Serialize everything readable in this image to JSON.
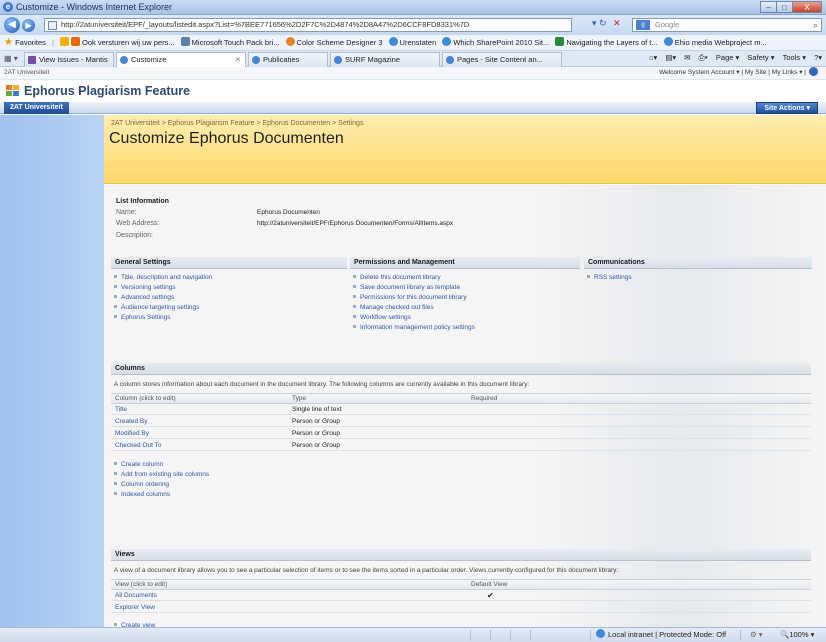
{
  "window": {
    "title": "Customize - Windows Internet Explorer",
    "min": "–",
    "max": "□",
    "close": "X"
  },
  "address": {
    "url": "http://2atuniversiteit/EPF/_layouts/listedit.aspx?List=%7BEE771656%2D2F7C%2D4874%2D8A47%2D6CCF8FD8331%7D",
    "search_placeholder": "Google",
    "google": "g"
  },
  "favorites": {
    "label": "Favorites",
    "items": [
      "Ook versturen wij uw pers...",
      "Microsoft Touch Pack bri...",
      "Color Scheme Designer 3",
      "Urenstaten",
      "Which SharePoint 2010 Sit...",
      "Navigating the Layers of t...",
      "Ehio media Webproject m..."
    ]
  },
  "tabs": [
    "View Issues - Mantis",
    "Customize",
    "Publicaties",
    "SURF Magazine",
    "Pages - Site Content an..."
  ],
  "commands": [
    "Page ▾",
    "Safety ▾",
    "Tools ▾",
    "?▾"
  ],
  "site": {
    "topleft": "2AT Universiteit",
    "welcome": "Welcome System Account ▾ | My Site | My Links ▾ |",
    "name": "Ephorus Plagiarism Feature",
    "nav_tab": "2AT Universiteit",
    "site_actions": "Site Actions ▾"
  },
  "page": {
    "breadcrumb": "2AT Universiteit > Ephorus Plagiarism Feature > Ephorus Documenten > Settings",
    "title": "Customize Ephorus Documenten"
  },
  "list_info": {
    "heading": "List Information",
    "name_label": "Name:",
    "name_value": "Ephorus Documenten",
    "web_label": "Web Address:",
    "web_value": "http://2atuniversiteit/EPF/Ephorus Documenten/Forms/AllItems.aspx",
    "desc_label": "Description:"
  },
  "general": {
    "heading": "General Settings",
    "links": [
      "Title, description and navigation",
      "Versioning settings",
      "Advanced settings",
      "Audience targeting settings",
      "Ephorus Settings"
    ]
  },
  "permissions": {
    "heading": "Permissions and Management",
    "links": [
      "Delete this document library",
      "Save document library as template",
      "Permissions for this document library",
      "Manage checked out files",
      "Workflow settings",
      "Information management policy settings"
    ]
  },
  "communications": {
    "heading": "Communications",
    "links": [
      "RSS settings"
    ]
  },
  "columns": {
    "heading": "Columns",
    "description": "A column stores information about each document in the document library. The following columns are currently available in this document library:",
    "headers": [
      "Column (click to edit)",
      "Type",
      "Required"
    ],
    "rows": [
      {
        "name": "Title",
        "type": "Single line of text"
      },
      {
        "name": "Created By",
        "type": "Person or Group"
      },
      {
        "name": "Modified By",
        "type": "Person or Group"
      },
      {
        "name": "Checked Out To",
        "type": "Person or Group"
      }
    ],
    "links": [
      "Create column",
      "Add from existing site columns",
      "Column ordering",
      "Indexed columns"
    ]
  },
  "views": {
    "heading": "Views",
    "description": "A view of a document library allows you to see a particular selection of items or to see the items sorted in a particular order. Views currently configured for this document library:",
    "headers": [
      "View (click to edit)",
      "Default View"
    ],
    "rows": [
      {
        "name": "All Documents",
        "default": "✔"
      },
      {
        "name": "Explorer View",
        "default": ""
      }
    ],
    "create": "Create view"
  },
  "status": {
    "zone": "Local intranet | Protected Mode: Off",
    "zoom": "100%"
  }
}
